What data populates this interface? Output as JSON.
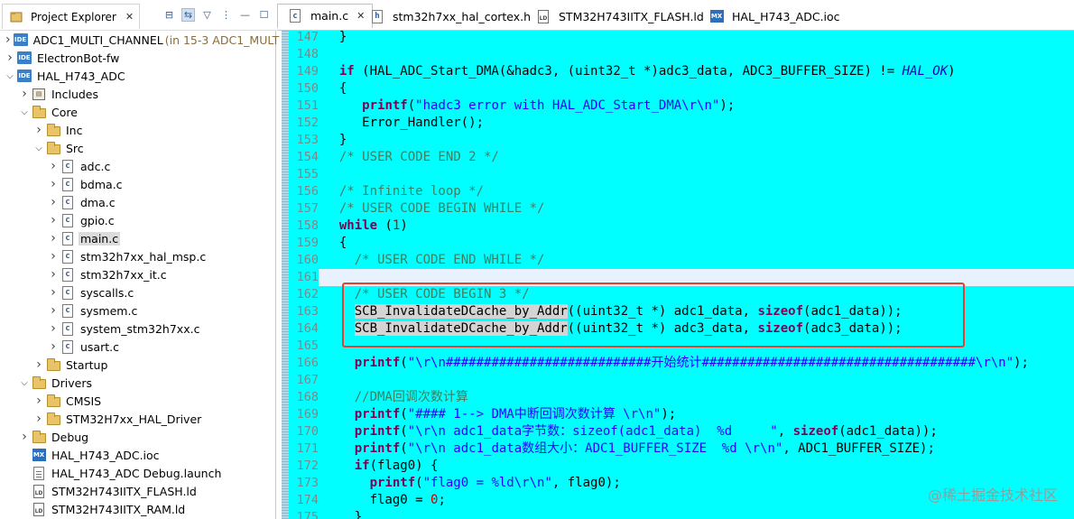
{
  "explorer": {
    "title": "Project Explorer",
    "close": "✕",
    "tools": [
      "collapse-all-icon",
      "link-with-editor-icon",
      "filter-icon",
      "view-menu-icon",
      "minimize-icon",
      "maximize-icon"
    ],
    "items": [
      {
        "label": "ADC1_MULTI_CHANNEL",
        "extra": " (in 15-3 ADC1_MULT",
        "depth": 0,
        "expanded": false,
        "icon": "ide"
      },
      {
        "label": "ElectronBot-fw",
        "extra": "",
        "depth": 0,
        "expanded": false,
        "icon": "ide"
      },
      {
        "label": "HAL_H743_ADC",
        "extra": "",
        "depth": 0,
        "expanded": true,
        "icon": "ide"
      },
      {
        "label": "Includes",
        "extra": "",
        "depth": 1,
        "expanded": false,
        "icon": "lib"
      },
      {
        "label": "Core",
        "extra": "",
        "depth": 1,
        "expanded": true,
        "icon": "folder"
      },
      {
        "label": "Inc",
        "extra": "",
        "depth": 2,
        "expanded": false,
        "icon": "folder"
      },
      {
        "label": "Src",
        "extra": "",
        "depth": 2,
        "expanded": true,
        "icon": "folder"
      },
      {
        "label": "adc.c",
        "extra": "",
        "depth": 3,
        "expanded": false,
        "icon": "c"
      },
      {
        "label": "bdma.c",
        "extra": "",
        "depth": 3,
        "expanded": false,
        "icon": "c"
      },
      {
        "label": "dma.c",
        "extra": "",
        "depth": 3,
        "expanded": false,
        "icon": "c"
      },
      {
        "label": "gpio.c",
        "extra": "",
        "depth": 3,
        "expanded": false,
        "icon": "c"
      },
      {
        "label": "main.c",
        "extra": "",
        "depth": 3,
        "expanded": false,
        "icon": "c",
        "selected": true
      },
      {
        "label": "stm32h7xx_hal_msp.c",
        "extra": "",
        "depth": 3,
        "expanded": false,
        "icon": "c"
      },
      {
        "label": "stm32h7xx_it.c",
        "extra": "",
        "depth": 3,
        "expanded": false,
        "icon": "c"
      },
      {
        "label": "syscalls.c",
        "extra": "",
        "depth": 3,
        "expanded": false,
        "icon": "c"
      },
      {
        "label": "sysmem.c",
        "extra": "",
        "depth": 3,
        "expanded": false,
        "icon": "c"
      },
      {
        "label": "system_stm32h7xx.c",
        "extra": "",
        "depth": 3,
        "expanded": false,
        "icon": "c"
      },
      {
        "label": "usart.c",
        "extra": "",
        "depth": 3,
        "expanded": false,
        "icon": "c"
      },
      {
        "label": "Startup",
        "extra": "",
        "depth": 2,
        "expanded": false,
        "icon": "folder"
      },
      {
        "label": "Drivers",
        "extra": "",
        "depth": 1,
        "expanded": true,
        "icon": "folder"
      },
      {
        "label": "CMSIS",
        "extra": "",
        "depth": 2,
        "expanded": false,
        "icon": "folder"
      },
      {
        "label": "STM32H7xx_HAL_Driver",
        "extra": "",
        "depth": 2,
        "expanded": false,
        "icon": "folder"
      },
      {
        "label": "Debug",
        "extra": "",
        "depth": 1,
        "expanded": false,
        "icon": "folder"
      },
      {
        "label": "HAL_H743_ADC.ioc",
        "extra": "",
        "depth": 1,
        "noarrow": true,
        "icon": "mx"
      },
      {
        "label": "HAL_H743_ADC Debug.launch",
        "extra": "",
        "depth": 1,
        "noarrow": true,
        "icon": "doc"
      },
      {
        "label": "STM32H743IITX_FLASH.ld",
        "extra": "",
        "depth": 1,
        "noarrow": true,
        "icon": "ld"
      },
      {
        "label": "STM32H743IITX_RAM.ld",
        "extra": "",
        "depth": 1,
        "noarrow": true,
        "icon": "ld"
      }
    ]
  },
  "editor": {
    "tabs": [
      {
        "label": "main.c",
        "icon": "c",
        "active": true,
        "close": "✕"
      },
      {
        "label": "stm32h7xx_hal_cortex.h",
        "icon": "h",
        "active": false,
        "close": ""
      },
      {
        "label": "STM32H743IITX_FLASH.ld",
        "icon": "ld",
        "active": false,
        "close": ""
      },
      {
        "label": "HAL_H743_ADC.ioc",
        "icon": "mx",
        "active": false,
        "close": ""
      }
    ],
    "current_line": 161,
    "lines": [
      {
        "n": 147,
        "s": [
          [
            "  }",
            ""
          ]
        ]
      },
      {
        "n": 148,
        "s": []
      },
      {
        "n": 149,
        "s": [
          [
            "  ",
            ""
          ],
          [
            "if",
            "kw"
          ],
          [
            " (HAL_ADC_Start_DMA(&hadc3, (uint32_t *)adc3_data, ADC3_BUFFER_SIZE) != ",
            ""
          ],
          [
            "HAL_OK",
            "it"
          ],
          [
            ")",
            ""
          ]
        ]
      },
      {
        "n": 150,
        "s": [
          [
            "  {",
            ""
          ]
        ]
      },
      {
        "n": 151,
        "s": [
          [
            "     ",
            ""
          ],
          [
            "printf",
            "kw"
          ],
          [
            "(",
            ""
          ],
          [
            "\"hadc3 error with HAL_ADC_Start_DMA\\r\\n\"",
            "str"
          ],
          [
            ");",
            ""
          ]
        ]
      },
      {
        "n": 152,
        "s": [
          [
            "     Error_Handler();",
            ""
          ]
        ]
      },
      {
        "n": 153,
        "s": [
          [
            "  }",
            ""
          ]
        ]
      },
      {
        "n": 154,
        "s": [
          [
            "  /* USER CODE END 2 */",
            "cm"
          ]
        ]
      },
      {
        "n": 155,
        "s": []
      },
      {
        "n": 156,
        "s": [
          [
            "  /* Infinite loop */",
            "cm"
          ]
        ]
      },
      {
        "n": 157,
        "s": [
          [
            "  /* USER CODE BEGIN WHILE */",
            "cm"
          ]
        ]
      },
      {
        "n": 158,
        "s": [
          [
            "  ",
            ""
          ],
          [
            "while",
            "kw"
          ],
          [
            " (",
            ""
          ],
          [
            "1",
            "num"
          ],
          [
            ")",
            ""
          ]
        ]
      },
      {
        "n": 159,
        "s": [
          [
            "  {",
            ""
          ]
        ]
      },
      {
        "n": 160,
        "s": [
          [
            "    /* USER CODE END WHILE */",
            "cm"
          ]
        ]
      },
      {
        "n": 161,
        "s": []
      },
      {
        "n": 162,
        "s": [
          [
            "    /* USER CODE BEGIN 3 */",
            "cm"
          ]
        ]
      },
      {
        "n": 163,
        "s": [
          [
            "    ",
            ""
          ],
          [
            "SCB_InvalidateDCache_by_Addr",
            "hl"
          ],
          [
            "((uint32_t *) adc1_data, ",
            ""
          ],
          [
            "sizeof",
            "kw"
          ],
          [
            "(adc1_data));",
            ""
          ]
        ]
      },
      {
        "n": 164,
        "s": [
          [
            "    ",
            ""
          ],
          [
            "SCB_InvalidateDCache_by_Addr",
            "hl"
          ],
          [
            "((uint32_t *) adc3_data, ",
            ""
          ],
          [
            "sizeof",
            "kw"
          ],
          [
            "(adc3_data));",
            ""
          ]
        ]
      },
      {
        "n": 165,
        "s": []
      },
      {
        "n": 166,
        "s": [
          [
            "    ",
            ""
          ],
          [
            "printf",
            "kw"
          ],
          [
            "(",
            ""
          ],
          [
            "\"\\r\\n###########################开始统计####################################\\r\\n\"",
            "str"
          ],
          [
            ");",
            ""
          ]
        ]
      },
      {
        "n": 167,
        "s": []
      },
      {
        "n": 168,
        "s": [
          [
            "    //DMA回调次数计算",
            "cm"
          ]
        ]
      },
      {
        "n": 169,
        "s": [
          [
            "    ",
            ""
          ],
          [
            "printf",
            "kw"
          ],
          [
            "(",
            ""
          ],
          [
            "\"#### 1--> DMA中断回调次数计算 \\r\\n\"",
            "str"
          ],
          [
            ");",
            ""
          ]
        ]
      },
      {
        "n": 170,
        "s": [
          [
            "    ",
            ""
          ],
          [
            "printf",
            "kw"
          ],
          [
            "(",
            ""
          ],
          [
            "\"\\r\\n adc1_data字节数：sizeof(adc1_data)  %d     \"",
            "str"
          ],
          [
            ", ",
            ""
          ],
          [
            "sizeof",
            "kw"
          ],
          [
            "(adc1_data));",
            ""
          ]
        ]
      },
      {
        "n": 171,
        "s": [
          [
            "    ",
            ""
          ],
          [
            "printf",
            "kw"
          ],
          [
            "(",
            ""
          ],
          [
            "\"\\r\\n adc1_data数组大小：ADC1_BUFFER_SIZE  %d \\r\\n\"",
            "str"
          ],
          [
            ", ADC1_BUFFER_SIZE);",
            ""
          ]
        ]
      },
      {
        "n": 172,
        "s": [
          [
            "    ",
            ""
          ],
          [
            "if",
            "kw"
          ],
          [
            "(flag0) {",
            ""
          ]
        ]
      },
      {
        "n": 173,
        "s": [
          [
            "      ",
            ""
          ],
          [
            "printf",
            "kw"
          ],
          [
            "(",
            ""
          ],
          [
            "\"flag0 = %ld\\r\\n\"",
            "str"
          ],
          [
            ", flag0);",
            ""
          ]
        ]
      },
      {
        "n": 174,
        "s": [
          [
            "      flag0 = ",
            ""
          ],
          [
            "0",
            "num"
          ],
          [
            ";",
            ""
          ]
        ]
      },
      {
        "n": 175,
        "s": [
          [
            "    }",
            ""
          ]
        ]
      }
    ]
  },
  "colors": {
    "kw": "#7f0055",
    "str": "#2a00ff",
    "cm": "#3f7f5f",
    "num": "#c00000",
    "it": "#0000c0",
    "bg": "#00ffff",
    "highlight_box": "#e8402f"
  },
  "watermark": "@稀土掘金技术社区"
}
